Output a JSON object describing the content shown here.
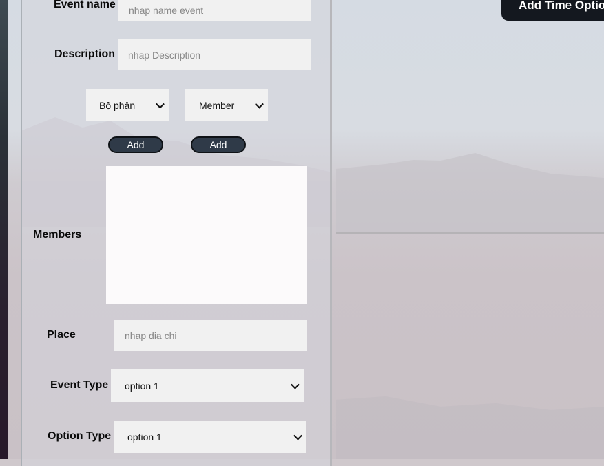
{
  "form": {
    "event_name": {
      "label": "Event name",
      "placeholder": "nhap name event"
    },
    "description": {
      "label": "Description",
      "placeholder": "nhap Description"
    },
    "department_select": {
      "value": "Bộ phận"
    },
    "member_select": {
      "value": "Member"
    },
    "add_department_button": "Add",
    "add_member_button": "Add",
    "members": {
      "label": "Members"
    },
    "place": {
      "label": "Place",
      "placeholder": "nhap dia chi"
    },
    "event_type": {
      "label": "Event Type",
      "value": "option 1"
    },
    "option_type": {
      "label": "Option Type",
      "value": "option 1"
    }
  },
  "right_panel": {
    "add_time_button": "Add Time Optio"
  },
  "colors": {
    "button_dark": "#2f3a48",
    "time_button": "#14181f",
    "input_bg": "#f1f1f1"
  }
}
